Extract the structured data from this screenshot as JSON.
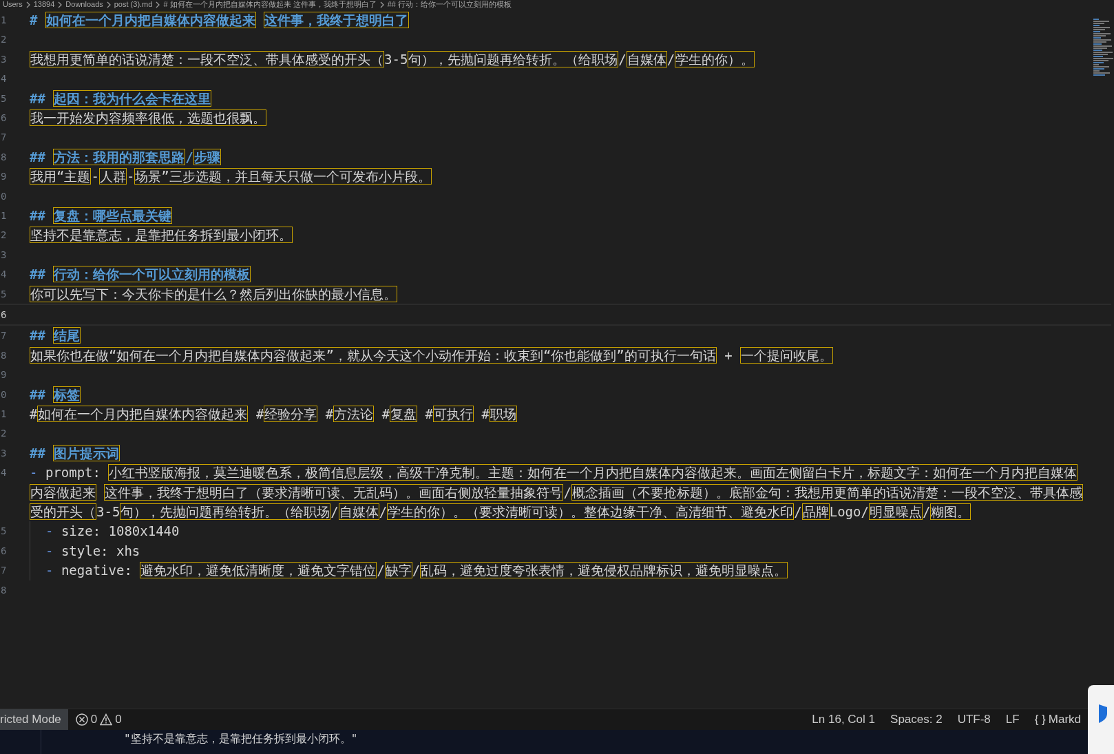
{
  "breadcrumb": [
    "Users",
    "13894",
    "Downloads",
    "post (3).md",
    "# 如何在一个月内把自媒体内容做起来 这件事，我终于想明白了",
    "## 行动：给你一个可以立刻用的模板"
  ],
  "editor": {
    "lines": [
      {
        "number": "1",
        "current": false,
        "segments": [
          {
            "text": "# ",
            "kind": "mark",
            "boxed": false
          },
          {
            "text": "如何在一个月内把自媒体内容做起来",
            "kind": "heading",
            "boxed": true
          },
          {
            "text": "这件事，我终于想明白了",
            "kind": "heading",
            "boxed": true
          }
        ]
      },
      {
        "number": "2",
        "current": false
      },
      {
        "number": "3",
        "current": false,
        "segments": [
          {
            "text": "我想用更简单的话说清楚：一段不空泛、带具体感受的开头（",
            "kind": "text",
            "boxed": true
          },
          {
            "text": "3-5",
            "kind": "text",
            "boxed": false
          },
          {
            "text": "句），先抛问题再给转折。（给职场",
            "kind": "text",
            "boxed": true
          },
          {
            "text": "/",
            "kind": "text",
            "boxed": false
          },
          {
            "text": "自媒体",
            "kind": "text",
            "boxed": true
          },
          {
            "text": "/",
            "kind": "text",
            "boxed": false
          },
          {
            "text": "学生的你）。",
            "kind": "text",
            "boxed": true
          }
        ]
      },
      {
        "number": "4",
        "current": false
      },
      {
        "number": "5",
        "current": false,
        "segments": [
          {
            "text": "## ",
            "kind": "mark",
            "boxed": false
          },
          {
            "text": "起因：我为什么会卡在这里",
            "kind": "heading",
            "boxed": true
          }
        ]
      },
      {
        "number": "6",
        "current": false,
        "segments": [
          {
            "text": "我一开始发内容频率很低，选题也很飘。",
            "kind": "text",
            "boxed": true
          }
        ]
      },
      {
        "number": "7",
        "current": false
      },
      {
        "number": "8",
        "current": false,
        "segments": [
          {
            "text": "## ",
            "kind": "mark",
            "boxed": false
          },
          {
            "text": "方法：我用的那套思路",
            "kind": "heading",
            "boxed": true
          },
          {
            "text": "/",
            "kind": "heading",
            "boxed": false
          },
          {
            "text": "步骤",
            "kind": "heading",
            "boxed": true
          }
        ]
      },
      {
        "number": "9",
        "current": false,
        "segments": [
          {
            "text": "我用“主题",
            "kind": "text",
            "boxed": true
          },
          {
            "text": "-",
            "kind": "text",
            "boxed": false
          },
          {
            "text": "人群",
            "kind": "text",
            "boxed": true
          },
          {
            "text": "-",
            "kind": "text",
            "boxed": false
          },
          {
            "text": "场景”三步选题，并且每天只做一个可发布小片段。",
            "kind": "text",
            "boxed": true
          }
        ]
      },
      {
        "number": "0",
        "current": false
      },
      {
        "number": "1",
        "current": false,
        "segments": [
          {
            "text": "## ",
            "kind": "mark",
            "boxed": false
          },
          {
            "text": "复盘：哪些点最关键",
            "kind": "heading",
            "boxed": true
          }
        ]
      },
      {
        "number": "2",
        "current": false,
        "segments": [
          {
            "text": "坚持不是靠意志，是靠把任务拆到最小闭环。",
            "kind": "text",
            "boxed": true
          }
        ]
      },
      {
        "number": "3",
        "current": false
      },
      {
        "number": "4",
        "current": false,
        "segments": [
          {
            "text": "## ",
            "kind": "mark",
            "boxed": false
          },
          {
            "text": "行动：给你一个可以立刻用的模板",
            "kind": "heading",
            "boxed": true
          }
        ]
      },
      {
        "number": "5",
        "current": false,
        "segments": [
          {
            "text": "你可以先写下：今天你卡的是什么？然后列出你缺的最小信息。",
            "kind": "text",
            "boxed": true
          }
        ]
      },
      {
        "number": "6",
        "current": true
      },
      {
        "number": "7",
        "current": false,
        "segments": [
          {
            "text": "## ",
            "kind": "mark",
            "boxed": false
          },
          {
            "text": "结尾",
            "kind": "heading",
            "boxed": true
          }
        ]
      },
      {
        "number": "8",
        "current": false,
        "segments": [
          {
            "text": "如果你也在做“如何在一个月内把自媒体内容做起来”，就从今天这个小动作开始：收束到“你也能做到”的可执行一句话",
            "kind": "text",
            "boxed": true
          },
          {
            "text": " + ",
            "kind": "text",
            "boxed": false
          },
          {
            "text": "一个提问收尾。",
            "kind": "text",
            "boxed": true
          }
        ]
      },
      {
        "number": "9",
        "current": false
      },
      {
        "number": "0",
        "current": false,
        "segments": [
          {
            "text": "## ",
            "kind": "mark",
            "boxed": false
          },
          {
            "text": "标签",
            "kind": "heading",
            "boxed": true
          }
        ]
      },
      {
        "number": "1",
        "current": false,
        "segments": [
          {
            "text": "#",
            "kind": "text",
            "boxed": false
          },
          {
            "text": "如何在一个月内把自媒体内容做起来",
            "kind": "text",
            "boxed": true
          },
          {
            "text": " #",
            "kind": "text",
            "boxed": false
          },
          {
            "text": "经验分享",
            "kind": "text",
            "boxed": true
          },
          {
            "text": " #",
            "kind": "text",
            "boxed": false
          },
          {
            "text": "方法论",
            "kind": "text",
            "boxed": true
          },
          {
            "text": " #",
            "kind": "text",
            "boxed": false
          },
          {
            "text": "复盘",
            "kind": "text",
            "boxed": true
          },
          {
            "text": " #",
            "kind": "text",
            "boxed": false
          },
          {
            "text": "可执行",
            "kind": "text",
            "boxed": true
          },
          {
            "text": " #",
            "kind": "text",
            "boxed": false
          },
          {
            "text": "职场",
            "kind": "text",
            "boxed": true
          }
        ]
      },
      {
        "number": "2",
        "current": false
      },
      {
        "number": "3",
        "current": false,
        "segments": [
          {
            "text": "## ",
            "kind": "mark",
            "boxed": false
          },
          {
            "text": "图片提示词",
            "kind": "heading",
            "boxed": true
          }
        ]
      },
      {
        "number": "4",
        "current": false,
        "segments": [
          {
            "text": "- ",
            "kind": "bullet",
            "boxed": false
          },
          {
            "text": "prompt: ",
            "kind": "text",
            "boxed": false
          },
          {
            "text": "小红书竖版海报，莫兰迪暖色系，极简信息层级，高级干净克制。主题：如何在一个月内把自媒体内容做起来。画面左侧留白卡片，标题文字：如何在一个月内把自媒体内容做起来",
            "kind": "text",
            "boxed": true
          },
          {
            "text": "这件事，我终于想明白了（要求清晰可读、无乱码）。画面右侧放轻量抽象符号",
            "kind": "text",
            "boxed": true
          },
          {
            "text": "/",
            "kind": "text",
            "boxed": false
          },
          {
            "text": "概念插画（不要抢标题）。底部金句：我想用更简单的话说清楚：一段不空泛、带具体感受的开头（",
            "kind": "text",
            "boxed": true
          },
          {
            "text": "3-5",
            "kind": "text",
            "boxed": false
          },
          {
            "text": "句），先抛问题再给转折。（给职场",
            "kind": "text",
            "boxed": true
          },
          {
            "text": "/",
            "kind": "text",
            "boxed": false
          },
          {
            "text": "自媒体",
            "kind": "text",
            "boxed": true
          },
          {
            "text": "/",
            "kind": "text",
            "boxed": false
          },
          {
            "text": "学生的你）。（要求清晰可读）。整体边缘干净、高清细节、避免水印",
            "kind": "text",
            "boxed": true
          },
          {
            "text": "/",
            "kind": "text",
            "boxed": false
          },
          {
            "text": "品牌",
            "kind": "text",
            "boxed": true
          },
          {
            "text": "Logo/",
            "kind": "text",
            "boxed": false
          },
          {
            "text": "明显噪点",
            "kind": "text",
            "boxed": true
          },
          {
            "text": "/",
            "kind": "text",
            "boxed": false
          },
          {
            "text": "糊图。",
            "kind": "text",
            "boxed": true
          }
        ],
        "children": [
          {
            "number": "5",
            "current": false,
            "segments": [
              {
                "text": "- ",
                "kind": "bullet",
                "boxed": false
              },
              {
                "text": "size: 1080x1440",
                "kind": "text",
                "boxed": false
              }
            ]
          },
          {
            "number": "6",
            "current": false,
            "segments": [
              {
                "text": "- ",
                "kind": "bullet",
                "boxed": false
              },
              {
                "text": "style: xhs",
                "kind": "text",
                "boxed": false
              }
            ]
          },
          {
            "number": "7",
            "current": false,
            "segments": [
              {
                "text": "- ",
                "kind": "bullet",
                "boxed": false
              },
              {
                "text": "negative: ",
                "kind": "text",
                "boxed": false
              },
              {
                "text": "避免水印，避免低清晰度，避免文字错位",
                "kind": "text",
                "boxed": true
              },
              {
                "text": "/",
                "kind": "text",
                "boxed": false
              },
              {
                "text": "缺字",
                "kind": "text",
                "boxed": true
              },
              {
                "text": "/",
                "kind": "text",
                "boxed": false
              },
              {
                "text": "乱码，避免过度夸张表情，避免侵权品牌标识，避免明显噪点。",
                "kind": "text",
                "boxed": true
              }
            ]
          }
        ]
      },
      {
        "number": "8",
        "current": false
      }
    ]
  },
  "status_bar": {
    "mode": "ricted Mode",
    "errors": "0",
    "warnings": "0",
    "items": [
      "Ln 16, Col 1",
      "Spaces: 2",
      "UTF-8",
      "LF"
    ],
    "language_icon": "{ }",
    "language": "Markd"
  },
  "panel": {
    "lines": [
      "\"坚持不是靠意志，是靠把任务拆到最小闭环。\""
    ]
  }
}
